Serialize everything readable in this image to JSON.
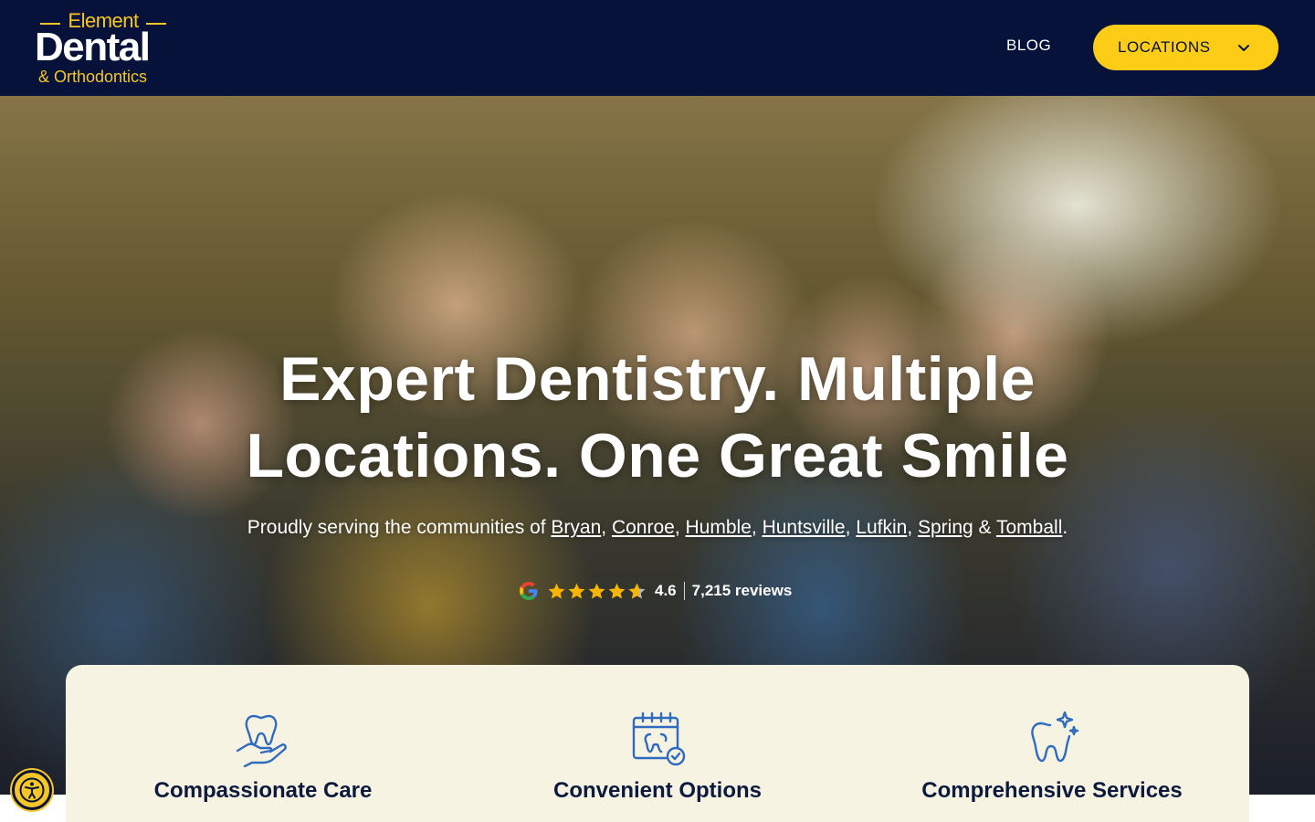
{
  "header": {
    "logo": {
      "top": "Element",
      "main": "Dental",
      "sub": "& Orthodontics"
    },
    "nav": {
      "blog_label": "BLOG",
      "locations_label": "LOCATIONS"
    }
  },
  "hero": {
    "title_line1": "Expert Dentistry. Multiple",
    "title_line2": "Locations. One Great Smile",
    "subtitle_prefix": "Proudly serving the communities of ",
    "communities": [
      "Bryan",
      "Conroe",
      "Humble",
      "Huntsville",
      "Lufkin",
      "Spring",
      "Tomball"
    ],
    "subtitle_end": ".",
    "rating": {
      "value": "4.6",
      "reviews": "7,215 reviews",
      "stars": 4.6,
      "max_stars": 5
    }
  },
  "features": [
    {
      "label": "Compassionate Care",
      "icon": "tooth-in-hand-icon"
    },
    {
      "label": "Convenient Options",
      "icon": "calendar-tooth-check-icon"
    },
    {
      "label": "Comprehensive Services",
      "icon": "sparkling-tooth-icon"
    }
  ],
  "colors": {
    "header_bg": "#06123a",
    "accent_yellow": "#fccc16",
    "feature_card_bg": "#f7f3e3",
    "icon_blue": "#2f6bbf",
    "star_gold": "#f7b500"
  }
}
